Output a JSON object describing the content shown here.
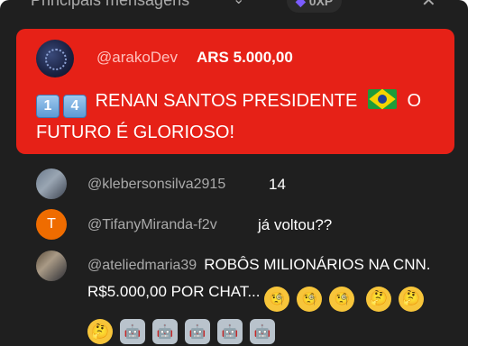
{
  "header": {
    "title": "Principais mensagens",
    "chevron_glyph": "⌄",
    "xp_label": "0XP",
    "close_glyph": "✕"
  },
  "superchat": {
    "author": "@arakoDev",
    "amount": "ARS 5.000,00",
    "keycap_1": "1",
    "keycap_2": "4",
    "message_part1": "RENAN SANTOS PRESIDENTE",
    "message_part2": "O FUTURO É GLORIOSO!",
    "bg_color": "#e62117"
  },
  "messages": [
    {
      "author": "@klebersonsilva2915",
      "text": "14"
    },
    {
      "author": "@TifanyMiranda-f2v",
      "avatar_letter": "T",
      "text": "já voltou??"
    },
    {
      "author": "@ateliedmaria39",
      "text": "ROBÔS MILIONÁRIOS NA CNN. R$5.000,00 POR CHAT..."
    }
  ],
  "emoji": {
    "monocle": "🧐",
    "thinking": "🤔",
    "robot": "🤖"
  }
}
